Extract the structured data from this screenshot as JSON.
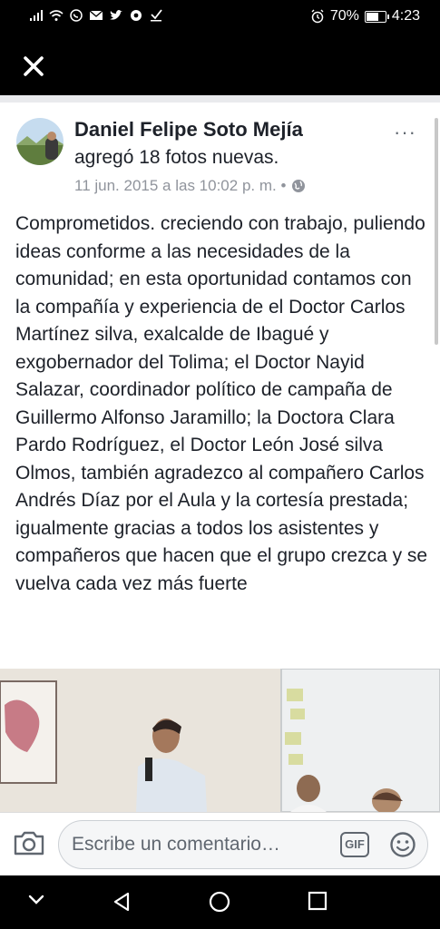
{
  "status_bar": {
    "battery_percent_label": "70%",
    "battery_level": 0.7,
    "time": "4:23",
    "icons": [
      "signal-icon",
      "wifi-icon",
      "whatsapp-icon",
      "mail-icon",
      "twitter-icon",
      "chrome-icon",
      "download-check-icon",
      "alarm-icon",
      "battery-icon"
    ]
  },
  "app_bar": {
    "close_icon": "close-icon"
  },
  "post": {
    "author": "Daniel Felipe Soto Mejía",
    "action": "agregó 18 fotos nuevas.",
    "timestamp": "11 jun. 2015 a las 10:02 p. m. •",
    "privacy_icon": "globe-icon",
    "more_label": "···",
    "text": "Comprometidos. creciendo con trabajo, puliendo ideas conforme a las necesidades de la comunidad; en esta oportunidad contamos con la compañía y experiencia de el Doctor Carlos Martínez silva, exalcalde de Ibagué y exgobernador del Tolima; el Doctor Nayid Salazar, coordinador político de campaña de Guillermo Alfonso Jaramillo; la Doctora Clara Pardo Rodríguez, el Doctor León José silva Olmos, también agradezco al compañero Carlos Andrés Díaz por el Aula y la cortesía prestada; igualmente gracias a todos los asistentes y compañeros que hacen que el grupo crezca y se vuelva cada vez más fuerte"
  },
  "composer": {
    "placeholder": "Escribe un comentario…",
    "gif_label": "GIF",
    "camera_icon": "camera-icon",
    "emoji_icon": "emoji-icon"
  },
  "nav_bar": {
    "icons": [
      "chevron-down-icon",
      "back-icon",
      "home-icon",
      "recents-icon"
    ]
  },
  "colors": {
    "accent": "#1d2129",
    "meta": "#90949c",
    "background": "#000000"
  }
}
